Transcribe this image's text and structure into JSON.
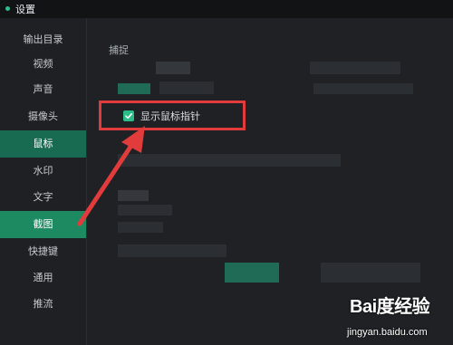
{
  "window": {
    "title": "设置"
  },
  "sidebar": {
    "items": [
      {
        "label": "输出目录"
      },
      {
        "label": "视频"
      },
      {
        "label": "声音"
      },
      {
        "label": "摄像头"
      },
      {
        "label": "鼠标"
      },
      {
        "label": "水印"
      },
      {
        "label": "文字"
      },
      {
        "label": "截图"
      },
      {
        "label": "快捷键"
      },
      {
        "label": "通用"
      },
      {
        "label": "推流"
      }
    ]
  },
  "main": {
    "section_title": "捕捉",
    "checkbox": {
      "label": "显示鼠标指针",
      "checked": true
    }
  },
  "colors": {
    "accent": "#2bbd88",
    "highlight": "#e23b3b",
    "active_item": "#186b50"
  },
  "watermark": {
    "logo_text": "Bai度经验",
    "url_text": "jingyan.baidu.com"
  }
}
